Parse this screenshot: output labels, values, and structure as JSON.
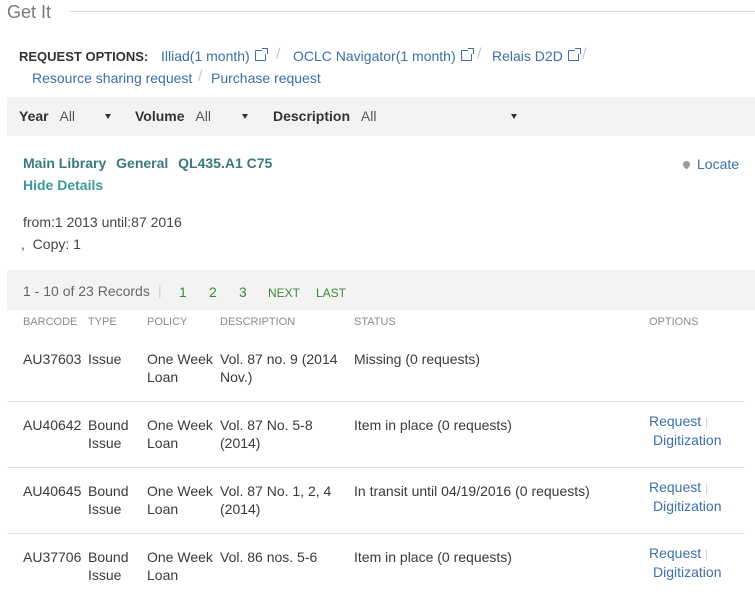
{
  "section": {
    "title": "Get It"
  },
  "request_options": {
    "label": "REQUEST OPTIONS:",
    "links": [
      {
        "label": "Illiad(1 month)",
        "icon": "external-link-icon"
      },
      {
        "label": "OCLC Navigator(1 month)",
        "icon": "external-link-icon"
      },
      {
        "label": "Relais D2D",
        "icon": "external-link-icon"
      },
      {
        "label": "Resource sharing request"
      },
      {
        "label": "Purchase request"
      }
    ]
  },
  "filters": {
    "year": {
      "label": "Year",
      "value": "All"
    },
    "volume": {
      "label": "Volume",
      "value": "All"
    },
    "description": {
      "label": "Description",
      "value": "All"
    }
  },
  "holding": {
    "library": "Main Library",
    "location": "General",
    "call_number": "QL435.A1 C75",
    "locate_label": "Locate",
    "hide_details": "Hide Details",
    "coverage": "from:1 2013 until:87 2016",
    "copy": ",  Copy: 1"
  },
  "pager": {
    "summary": "1 - 10 of 23 Records",
    "pages": [
      "1",
      "2",
      "3"
    ],
    "next": "NEXT",
    "last": "LAST"
  },
  "table": {
    "headers": [
      "BARCODE",
      "TYPE",
      "POLICY",
      "DESCRIPTION",
      "STATUS",
      "OPTIONS"
    ],
    "rows": [
      {
        "barcode": "AU37603",
        "type": [
          "Issue",
          ""
        ],
        "policy": [
          "One Week",
          "Loan"
        ],
        "description": [
          "Vol. 87 no. 9 (2014",
          "Nov.)"
        ],
        "status": "Missing (0 requests)",
        "options": []
      },
      {
        "barcode": "AU40642",
        "type": [
          "Bound",
          "Issue"
        ],
        "policy": [
          "One Week",
          "Loan"
        ],
        "description": [
          "Vol. 87 No. 5-8",
          "(2014)"
        ],
        "status": "Item in place (0 requests)",
        "options": [
          "Request",
          "Digitization"
        ]
      },
      {
        "barcode": "AU40645",
        "type": [
          "Bound",
          "Issue"
        ],
        "policy": [
          "One Week",
          "Loan"
        ],
        "description": [
          "Vol. 87 No. 1, 2, 4",
          "(2014)"
        ],
        "status": "In transit until 04/19/2016 (0 requests)",
        "options": [
          "Request",
          "Digitization"
        ]
      },
      {
        "barcode": "AU37706",
        "type": [
          "Bound",
          "Issue"
        ],
        "policy": [
          "One Week",
          "Loan"
        ],
        "description": [
          "Vol. 86 nos. 5-6",
          ""
        ],
        "status": "Item in place (0 requests)",
        "options": [
          "Request",
          "Digitization"
        ]
      }
    ]
  }
}
